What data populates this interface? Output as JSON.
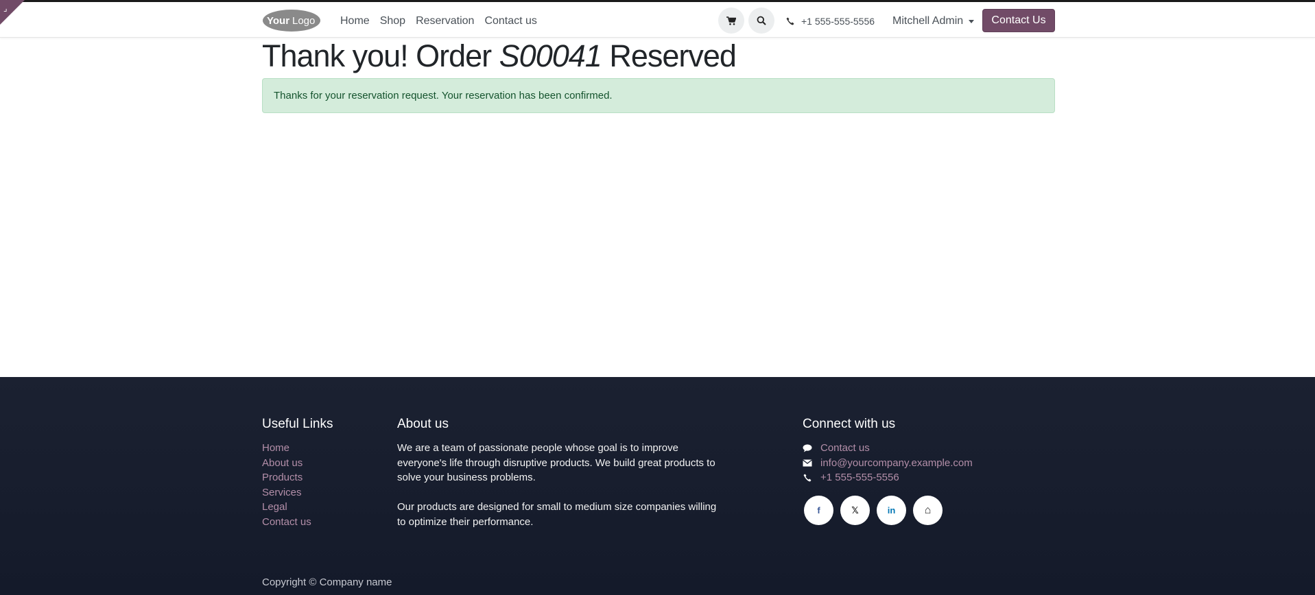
{
  "header": {
    "logo_text_your": "Your",
    "logo_text_logo": "Logo",
    "nav": [
      {
        "label": "Home"
      },
      {
        "label": "Shop"
      },
      {
        "label": "Reservation"
      },
      {
        "label": "Contact us"
      }
    ],
    "phone": "+1 555-555-5556",
    "user": "Mitchell Admin",
    "cta_label": "Contact Us"
  },
  "main": {
    "title_prefix": "Thank you! Order",
    "order_number": "S00041",
    "title_suffix": "Reserved",
    "alert_text": "Thanks for your reservation request. Your reservation has been confirmed."
  },
  "footer": {
    "useful_links_title": "Useful Links",
    "useful_links": [
      "Home",
      "About us",
      "Products",
      "Services",
      "Legal",
      "Contact us"
    ],
    "about_title": "About us",
    "about_paragraphs": [
      "We are a team of passionate people whose goal is to improve everyone's life through disruptive products. We build great products to solve your business problems.",
      "Our products are designed for small to medium size companies willing to optimize their performance."
    ],
    "connect_title": "Connect with us",
    "connect_items": [
      {
        "icon": "comment-icon",
        "label": "Contact us"
      },
      {
        "icon": "envelope-icon",
        "label": "info@yourcompany.example.com"
      },
      {
        "icon": "phone-icon",
        "label": "+1 555-555-5556"
      }
    ],
    "socials": [
      {
        "icon": "facebook-icon",
        "glyph": "f",
        "color": "#3b5998"
      },
      {
        "icon": "x-twitter-icon",
        "glyph": "𝕏",
        "color": "#111111"
      },
      {
        "icon": "linkedin-icon",
        "glyph": "in",
        "color": "#0077b5"
      },
      {
        "icon": "home-icon",
        "glyph": "⌂",
        "color": "#222222"
      }
    ],
    "copyright": "Copyright © Company name"
  },
  "colors": {
    "brand": "#714b67",
    "link": "#b48fa9",
    "success_bg": "#d4ecdb",
    "footer_bg": "#1b2131"
  }
}
